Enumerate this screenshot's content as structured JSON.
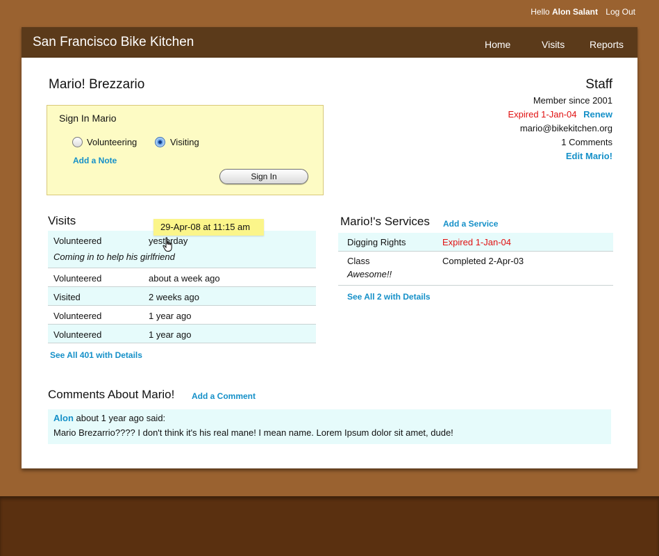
{
  "user_bar": {
    "greeting": "Hello",
    "user_name": "Alon Salant",
    "logout": "Log Out"
  },
  "header": {
    "title": "San Francisco Bike Kitchen",
    "nav": [
      "Home",
      "Visits",
      "Reports"
    ]
  },
  "member": {
    "name": "Mario! Brezzario"
  },
  "sign_in": {
    "title": "Sign In Mario",
    "options": [
      "Volunteering",
      "Visiting"
    ],
    "selected": "Visiting",
    "add_note": "Add a Note",
    "button": "Sign In"
  },
  "staff": {
    "title": "Staff",
    "member_since": "Member since 2001",
    "expired": "Expired 1-Jan-04",
    "renew": "Renew",
    "email": "mario@bikekitchen.org",
    "comments_count": "1 Comments",
    "edit": "Edit Mario!"
  },
  "visits": {
    "title": "Visits",
    "tooltip": "29-Apr-08  at 11:15 am",
    "rows": [
      {
        "type": "Volunteered",
        "when": "yesterday",
        "note": "Coming in to help his girlfriend"
      },
      {
        "type": "Volunteered",
        "when": "about a week ago"
      },
      {
        "type": "Visited",
        "when": "2 weeks ago"
      },
      {
        "type": "Volunteered",
        "when": "1 year ago"
      },
      {
        "type": "Volunteered",
        "when": "1 year ago"
      }
    ],
    "see_all": "See All 401 with Details"
  },
  "services": {
    "title": "Mario!'s Services",
    "add": "Add a Service",
    "rows": [
      {
        "name": "Digging Rights",
        "status": "Expired 1-Jan-04"
      },
      {
        "name": "Class",
        "status": "Completed 2-Apr-03",
        "note": "Awesome!!"
      }
    ],
    "see_all": "See All 2 with Details"
  },
  "comments": {
    "title": "Comments About Mario!",
    "add": "Add a Comment",
    "items": [
      {
        "author": "Alon",
        "meta": "about 1 year ago said:",
        "text": "Mario Brezarrio???? I don't think it's his real mane! I mean name. Lorem Ipsum dolor sit amet, dude!"
      }
    ]
  },
  "colors": {
    "link": "#1590c8",
    "expired": "#e01010",
    "header": "#5b3a1a",
    "page_bg": "#9a6230",
    "row_shade": "#e6fbfb",
    "signin_bg": "#fdfbc4"
  }
}
